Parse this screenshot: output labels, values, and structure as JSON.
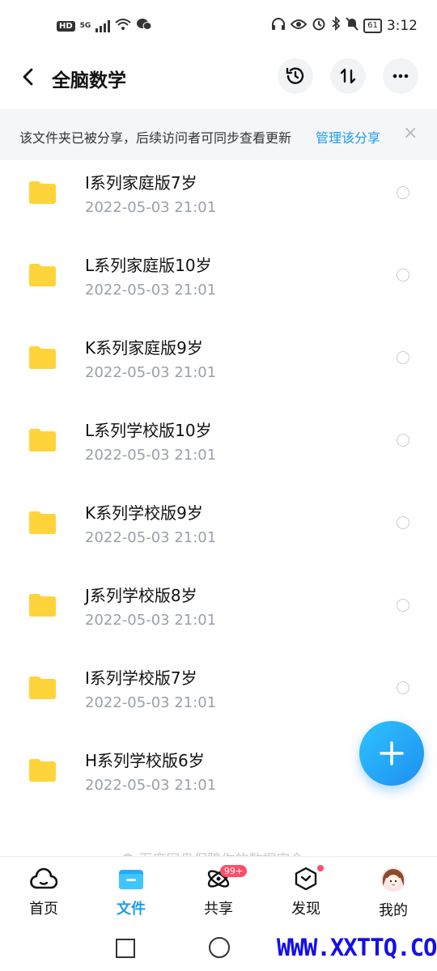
{
  "status_bar": {
    "left_badge": "HD",
    "network": "5G",
    "battery": "61",
    "time": "3:12"
  },
  "header": {
    "title": "全脑数学"
  },
  "banner": {
    "text": "该文件夹已被分享，后续访问者可同步查看更新",
    "link": "管理该分享",
    "close": "×"
  },
  "files": [
    {
      "name": "I系列家庭版7岁",
      "date": "2022-05-03  21:01"
    },
    {
      "name": "L系列家庭版10岁",
      "date": "2022-05-03  21:01"
    },
    {
      "name": "K系列家庭版9岁",
      "date": "2022-05-03  21:01"
    },
    {
      "name": "L系列学校版10岁",
      "date": "2022-05-03  21:01"
    },
    {
      "name": "K系列学校版9岁",
      "date": "2022-05-03  21:01"
    },
    {
      "name": "J系列学校版8岁",
      "date": "2022-05-03  21:01"
    },
    {
      "name": "I系列学校版7岁",
      "date": "2022-05-03  21:01"
    },
    {
      "name": "H系列学校版6岁",
      "date": "2022-05-03  21:01"
    }
  ],
  "footer_hint": "百度网盘保障你的数据安全",
  "tabs": [
    {
      "label": "首页",
      "icon": "cloud-icon"
    },
    {
      "label": "文件",
      "icon": "folder-icon",
      "active": true
    },
    {
      "label": "共享",
      "icon": "share-atom-icon",
      "badge": "99+"
    },
    {
      "label": "发现",
      "icon": "discover-box-icon"
    },
    {
      "label": "我的",
      "icon": "avatar"
    }
  ],
  "watermark": "WWW.XXTTQ.COM",
  "colors": {
    "accent": "#1e9de8",
    "folder": "#ffd43b",
    "badge": "#ff4d6a"
  }
}
